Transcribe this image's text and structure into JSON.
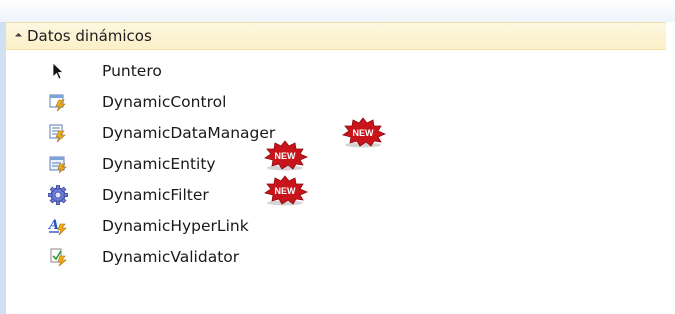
{
  "toolbox": {
    "group_title": "Datos dinámicos",
    "items": [
      {
        "label": "Puntero",
        "icon": "pointer-icon",
        "is_new": false
      },
      {
        "label": "DynamicControl",
        "icon": "dynamic-control-icon",
        "is_new": false
      },
      {
        "label": "DynamicDataManager",
        "icon": "dynamic-data-manager-icon",
        "is_new": true
      },
      {
        "label": "DynamicEntity",
        "icon": "dynamic-entity-icon",
        "is_new": true
      },
      {
        "label": "DynamicFilter",
        "icon": "dynamic-filter-icon",
        "is_new": true
      },
      {
        "label": "DynamicHyperLink",
        "icon": "dynamic-hyperlink-icon",
        "is_new": false
      },
      {
        "label": "DynamicValidator",
        "icon": "dynamic-validator-icon",
        "is_new": false
      }
    ],
    "new_badge_text": "NEW",
    "colors": {
      "header_bg": "#fbf0c8",
      "badge_red": "#c8141a",
      "frame_blue": "#cfe0f2"
    }
  }
}
